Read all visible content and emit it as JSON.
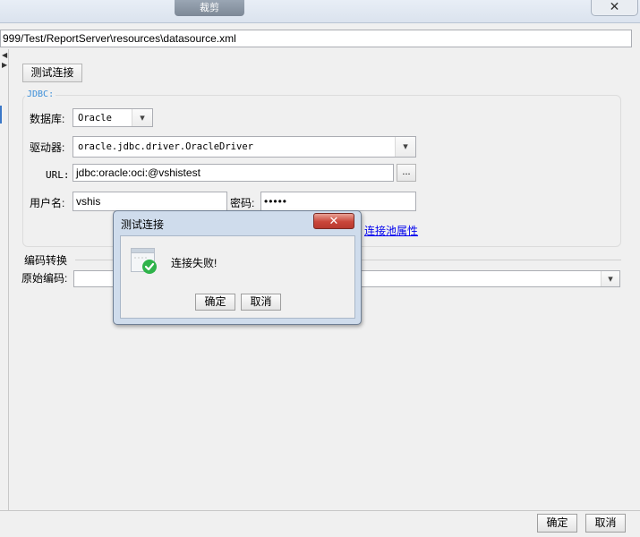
{
  "window": {
    "title_tab": "裁剪",
    "close_glyph": "✕"
  },
  "path": "999/Test/ReportServer\\resources\\datasource.xml",
  "toolbar": {
    "test_connection_label": "测试连接"
  },
  "jdbc": {
    "legend": "JDBC:",
    "database_label": "数据库:",
    "database_value": "Oracle",
    "driver_label": "驱动器:",
    "driver_value": "oracle.jdbc.driver.OracleDriver",
    "url_label": "URL:",
    "url_value": "jdbc:oracle:oci:@vshistest",
    "url_more_label": "...",
    "username_label": "用户名:",
    "username_value": "vshis",
    "password_label": "密码:",
    "password_value": "•••••",
    "pool_link_label": "连接池属性"
  },
  "encoding": {
    "section_label": "编码转换",
    "original_label": "原始编码:",
    "original_value": ""
  },
  "dialog": {
    "title": "测试连接",
    "close_glyph": "✕",
    "message": "连接失败!",
    "ok_label": "确定",
    "cancel_label": "取消",
    "icon": "success-check-icon"
  },
  "footer": {
    "ok_label": "确定",
    "cancel_label": "取消"
  },
  "colors": {
    "legend": "#3b8ed8",
    "link": "#0000ee",
    "success": "#2fb34a",
    "dialog_close": "#c9463a"
  }
}
